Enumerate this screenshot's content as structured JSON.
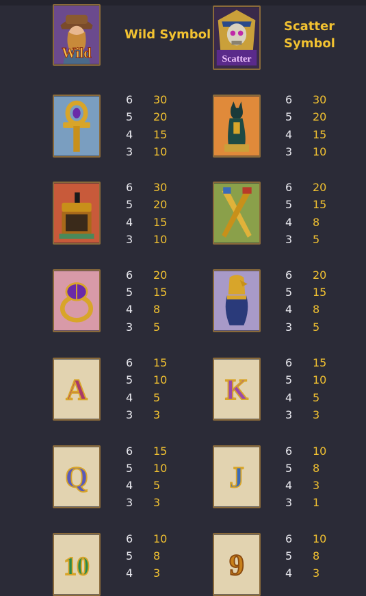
{
  "special": {
    "wild": {
      "title": "Wild Symbol",
      "badge": "Wild",
      "icon": "explorer-wild-icon"
    },
    "scatter": {
      "title_line1": "Scatter",
      "title_line2": "Symbol",
      "badge": "Scatter",
      "icon": "pharaoh-skull-scatter-icon"
    }
  },
  "symbols": [
    {
      "icon": "ankh-icon",
      "pays": [
        {
          "count": "6",
          "value": "30"
        },
        {
          "count": "5",
          "value": "20"
        },
        {
          "count": "4",
          "value": "15"
        },
        {
          "count": "3",
          "value": "10"
        }
      ]
    },
    {
      "icon": "bastet-cat-icon",
      "pays": [
        {
          "count": "6",
          "value": "30"
        },
        {
          "count": "5",
          "value": "20"
        },
        {
          "count": "4",
          "value": "15"
        },
        {
          "count": "3",
          "value": "10"
        }
      ]
    },
    {
      "icon": "treasure-chest-icon",
      "pays": [
        {
          "count": "6",
          "value": "30"
        },
        {
          "count": "5",
          "value": "20"
        },
        {
          "count": "4",
          "value": "15"
        },
        {
          "count": "3",
          "value": "10"
        }
      ]
    },
    {
      "icon": "golden-daggers-icon",
      "pays": [
        {
          "count": "6",
          "value": "20"
        },
        {
          "count": "5",
          "value": "15"
        },
        {
          "count": "4",
          "value": "8"
        },
        {
          "count": "3",
          "value": "5"
        }
      ]
    },
    {
      "icon": "scarab-ring-icon",
      "pays": [
        {
          "count": "6",
          "value": "20"
        },
        {
          "count": "5",
          "value": "15"
        },
        {
          "count": "4",
          "value": "8"
        },
        {
          "count": "3",
          "value": "5"
        }
      ]
    },
    {
      "icon": "canopic-jar-icon",
      "pays": [
        {
          "count": "6",
          "value": "20"
        },
        {
          "count": "5",
          "value": "15"
        },
        {
          "count": "4",
          "value": "8"
        },
        {
          "count": "3",
          "value": "5"
        }
      ]
    },
    {
      "icon": "letter-a-icon",
      "letter": "A",
      "pays": [
        {
          "count": "6",
          "value": "15"
        },
        {
          "count": "5",
          "value": "10"
        },
        {
          "count": "4",
          "value": "5"
        },
        {
          "count": "3",
          "value": "3"
        }
      ]
    },
    {
      "icon": "letter-k-icon",
      "letter": "K",
      "pays": [
        {
          "count": "6",
          "value": "15"
        },
        {
          "count": "5",
          "value": "10"
        },
        {
          "count": "4",
          "value": "5"
        },
        {
          "count": "3",
          "value": "3"
        }
      ]
    },
    {
      "icon": "letter-q-icon",
      "letter": "Q",
      "pays": [
        {
          "count": "6",
          "value": "15"
        },
        {
          "count": "5",
          "value": "10"
        },
        {
          "count": "4",
          "value": "5"
        },
        {
          "count": "3",
          "value": "3"
        }
      ]
    },
    {
      "icon": "letter-j-icon",
      "letter": "J",
      "pays": [
        {
          "count": "6",
          "value": "10"
        },
        {
          "count": "5",
          "value": "8"
        },
        {
          "count": "4",
          "value": "3"
        },
        {
          "count": "3",
          "value": "1"
        }
      ]
    },
    {
      "icon": "number-10-icon",
      "letter": "10",
      "pays": [
        {
          "count": "6",
          "value": "10"
        },
        {
          "count": "5",
          "value": "8"
        },
        {
          "count": "4",
          "value": "3"
        }
      ]
    },
    {
      "icon": "number-9-icon",
      "letter": "9",
      "pays": [
        {
          "count": "6",
          "value": "10"
        },
        {
          "count": "5",
          "value": "8"
        },
        {
          "count": "4",
          "value": "3"
        }
      ]
    }
  ],
  "colors": {
    "background": "#2b2b37",
    "count_text": "#e9e9ef",
    "value_text": "#f2c231",
    "tile_border": "#8a6a3a"
  }
}
